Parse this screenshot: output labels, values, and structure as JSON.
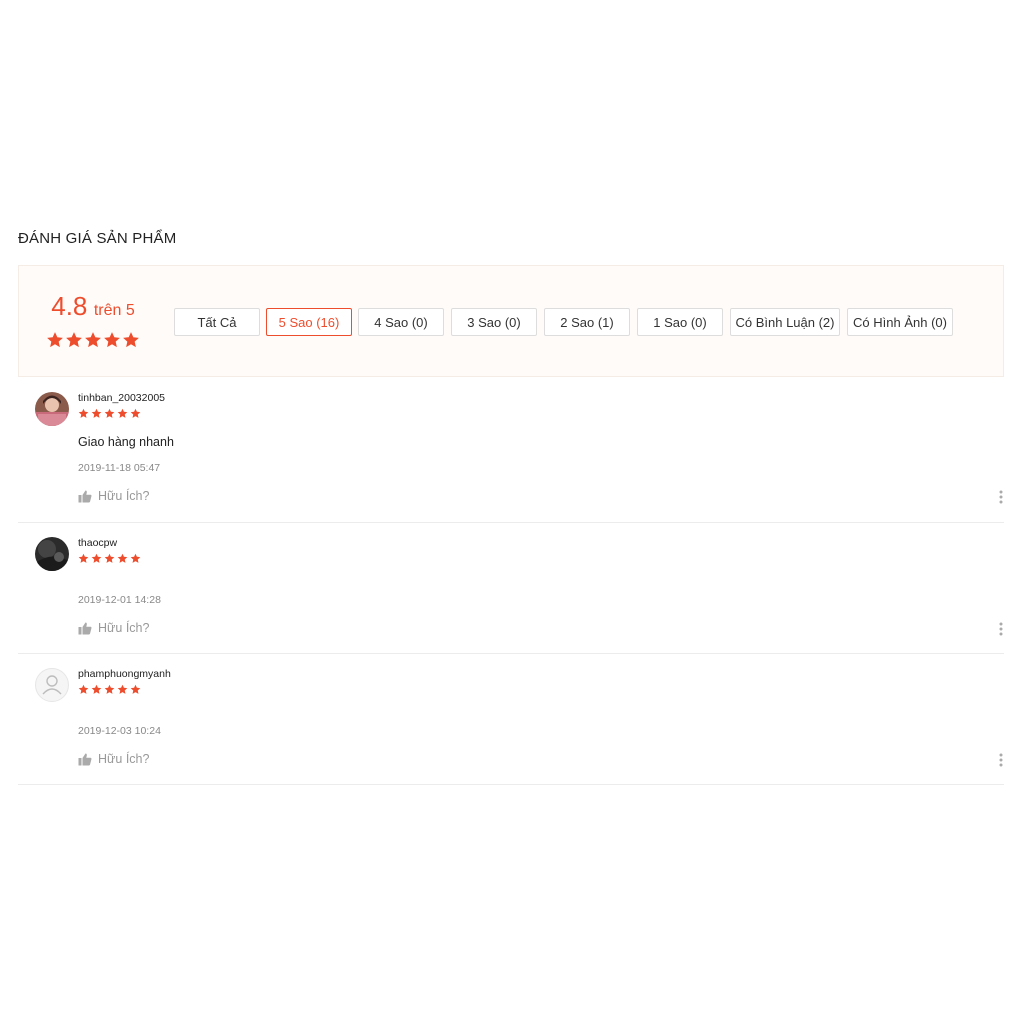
{
  "section": {
    "title": "ĐÁNH GIÁ SẢN PHẨM"
  },
  "rating": {
    "score": "4.8",
    "suffix": "trên 5",
    "stars": 5
  },
  "filters": [
    {
      "label": "Tất Cả",
      "active": false
    },
    {
      "label": "5 Sao (16)",
      "active": true
    },
    {
      "label": "4 Sao (0)",
      "active": false
    },
    {
      "label": "3 Sao (0)",
      "active": false
    },
    {
      "label": "2 Sao (1)",
      "active": false
    },
    {
      "label": "1 Sao (0)",
      "active": false
    },
    {
      "label": "Có Bình Luận (2)",
      "active": false
    },
    {
      "label": "Có Hình Ảnh (0)",
      "active": false
    }
  ],
  "reviews": [
    {
      "username": "tinhban_20032005",
      "stars": 5,
      "comment": "Giao hàng nhanh",
      "time": "2019-11-18 05:47",
      "helpful_label": "Hữu Ích?",
      "avatar": "photo-girl"
    },
    {
      "username": "thaocpw",
      "stars": 5,
      "comment": "",
      "time": "2019-12-01 14:28",
      "helpful_label": "Hữu Ích?",
      "avatar": "photo-dark"
    },
    {
      "username": "phamphuongmyanh",
      "stars": 5,
      "comment": "",
      "time": "2019-12-03 10:24",
      "helpful_label": "Hữu Ích?",
      "avatar": "default-user-icon"
    }
  ],
  "colors": {
    "accent": "#ee4d2d",
    "overview_bg": "#fffbf8",
    "muted": "#999999"
  }
}
